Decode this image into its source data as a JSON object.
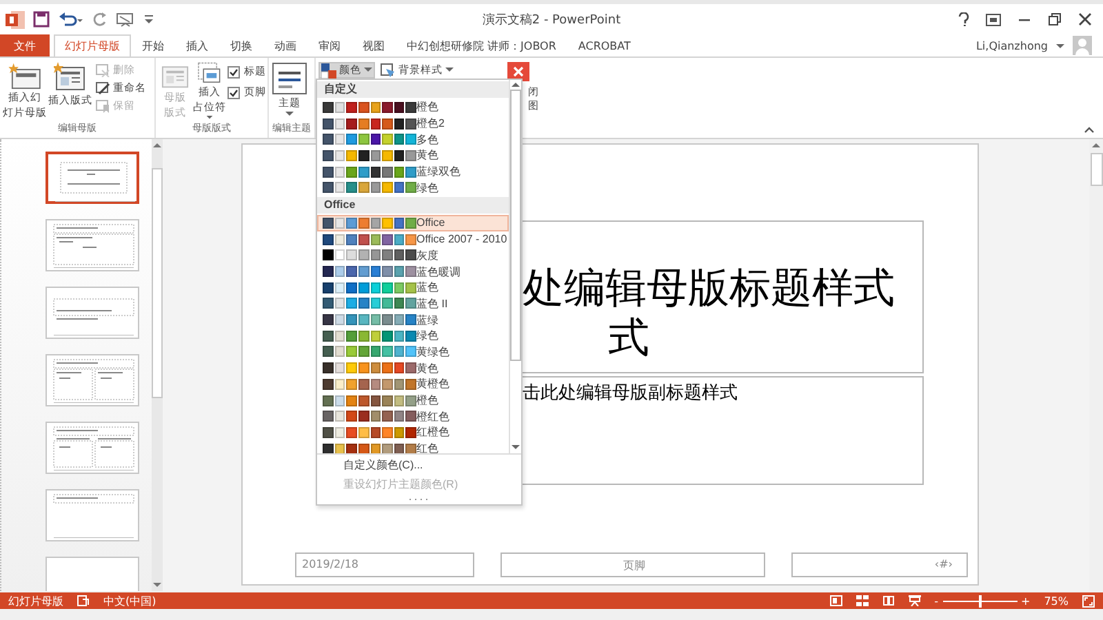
{
  "window": {
    "title": "演示文稿2 - PowerPoint"
  },
  "tabs": [
    {
      "label": "文件",
      "kind": "file",
      "selected": false
    },
    {
      "label": "幻灯片母版",
      "kind": "tab",
      "selected": true
    },
    {
      "label": "开始",
      "kind": "tab",
      "selected": false
    },
    {
      "label": "插入",
      "kind": "tab",
      "selected": false
    },
    {
      "label": "切换",
      "kind": "tab",
      "selected": false
    },
    {
      "label": "动画",
      "kind": "tab",
      "selected": false
    },
    {
      "label": "审阅",
      "kind": "tab",
      "selected": false
    },
    {
      "label": "视图",
      "kind": "tab",
      "selected": false
    },
    {
      "label": "中幻创想研修院 讲师：JOBOR",
      "kind": "tab",
      "selected": false
    },
    {
      "label": "ACROBAT",
      "kind": "tab",
      "selected": false
    }
  ],
  "account": {
    "name": "Li,Qianzhong"
  },
  "ribbon": {
    "groups": [
      {
        "label": "编辑母版",
        "items": [
          {
            "kind": "large",
            "lines": [
              "插入幻",
              "灯片母版"
            ],
            "disabled": false,
            "menu": false
          },
          {
            "kind": "large",
            "lines": [
              "插入版式"
            ],
            "disabled": false,
            "menu": false
          },
          {
            "kind": "stack",
            "items": [
              {
                "label": "删除",
                "disabled": true
              },
              {
                "label": "重命名",
                "disabled": false
              },
              {
                "label": "保留",
                "disabled": true
              }
            ]
          }
        ]
      },
      {
        "label": "母版版式",
        "items": [
          {
            "kind": "large",
            "lines": [
              "母版",
              "版式"
            ],
            "disabled": true,
            "menu": false
          },
          {
            "kind": "large",
            "lines": [
              "插入",
              "占位符"
            ],
            "disabled": false,
            "menu": true
          },
          {
            "kind": "checks",
            "items": [
              {
                "label": "标题",
                "checked": true
              },
              {
                "label": "页脚",
                "checked": true
              }
            ]
          }
        ]
      },
      {
        "label": "编辑主题",
        "items": [
          {
            "kind": "large",
            "lines": [
              "主题"
            ],
            "disabled": false,
            "menu": true
          }
        ]
      },
      {
        "items": [
          {
            "kind": "split",
            "items": [
              {
                "label": "颜色",
                "pressed": true
              },
              {
                "label": "背景样式",
                "pressed": false
              }
            ]
          }
        ]
      }
    ],
    "close_group": {
      "lines": [
        "闭",
        "图"
      ]
    }
  },
  "thumbnails": [
    {
      "kind": "title",
      "selected": true
    },
    {
      "kind": "content",
      "selected": false
    },
    {
      "kind": "section",
      "selected": false
    },
    {
      "kind": "two",
      "selected": false
    },
    {
      "kind": "comparison",
      "selected": false
    },
    {
      "kind": "title_only",
      "selected": false
    },
    {
      "kind": "blank",
      "selected": false
    }
  ],
  "slide": {
    "title_lines": [
      "处编辑母版标题样式",
      "式"
    ],
    "subtitle": "击此处编辑母版副标题样式",
    "date": "2019/2/18",
    "footer": "页脚",
    "page_number": "‹#›"
  },
  "colors_menu": {
    "sections": [
      {
        "header": "自定义",
        "palettes": [
          {
            "name": "橙色",
            "selected": false,
            "swatches": [
              {
                "color": "#3a3a3a"
              },
              {
                "color": "#e0e0e0"
              },
              {
                "color": "#c0201c"
              },
              {
                "color": "#d9531e"
              },
              {
                "color": "#e8a21a"
              },
              {
                "color": "#8b1a2c"
              },
              {
                "color": "#4a0f1f"
              },
              {
                "color": "#3a3a3a"
              }
            ]
          },
          {
            "name": "橙色2",
            "selected": false,
            "swatches": [
              {
                "color": "#44546a"
              },
              {
                "color": "#e7e6e6"
              },
              {
                "color": "#a51c1c"
              },
              {
                "color": "#e57d22"
              },
              {
                "color": "#c8261f"
              },
              {
                "color": "#d55a1a"
              },
              {
                "color": "#222222"
              },
              {
                "color": "#555555"
              }
            ]
          },
          {
            "name": "多色",
            "selected": false,
            "swatches": [
              {
                "color": "#44546a"
              },
              {
                "color": "#e7e6e6"
              },
              {
                "color": "#1e9be0"
              },
              {
                "color": "#8dc63f"
              },
              {
                "color": "#4b16a8"
              },
              {
                "color": "#c4d12d"
              },
              {
                "color": "#0d9488"
              },
              {
                "color": "#13b5d8"
              }
            ]
          },
          {
            "name": "黄色",
            "selected": false,
            "swatches": [
              {
                "color": "#44546a"
              },
              {
                "color": "#e7e6e6"
              },
              {
                "color": "#f5b800"
              },
              {
                "color": "#222222"
              },
              {
                "color": "#999999"
              },
              {
                "color": "#f5b800"
              },
              {
                "color": "#222222"
              },
              {
                "color": "#999999"
              }
            ]
          },
          {
            "name": "蓝绿双色",
            "selected": false,
            "swatches": [
              {
                "color": "#44546a"
              },
              {
                "color": "#e7e6e6"
              },
              {
                "color": "#6aa61b"
              },
              {
                "color": "#2f9dc8"
              },
              {
                "color": "#333333"
              },
              {
                "color": "#777777"
              },
              {
                "color": "#6aa61b"
              },
              {
                "color": "#2f9dc8"
              }
            ]
          },
          {
            "name": "绿色",
            "selected": false,
            "swatches": [
              {
                "color": "#44546a"
              },
              {
                "color": "#e7e6e6"
              },
              {
                "color": "#268f8a"
              },
              {
                "color": "#d9a63a"
              },
              {
                "color": "#999999"
              },
              {
                "color": "#f5b800"
              },
              {
                "color": "#4472c4"
              },
              {
                "color": "#70ad47"
              }
            ]
          }
        ]
      },
      {
        "header": "Office",
        "palettes": [
          {
            "name": "Office",
            "selected": true,
            "swatches": [
              {
                "color": "#44546a"
              },
              {
                "color": "#e7e6e6"
              },
              {
                "color": "#5b9bd5"
              },
              {
                "color": "#ed7d31"
              },
              {
                "color": "#a5a5a5"
              },
              {
                "color": "#ffc000"
              },
              {
                "color": "#4472c4"
              },
              {
                "color": "#70ad47"
              }
            ]
          },
          {
            "name": "Office 2007 - 2010",
            "selected": false,
            "swatches": [
              {
                "color": "#1f497d"
              },
              {
                "color": "#eeece1"
              },
              {
                "color": "#4f81bd"
              },
              {
                "color": "#c0504d"
              },
              {
                "color": "#9bbb59"
              },
              {
                "color": "#8064a2"
              },
              {
                "color": "#4bacc6"
              },
              {
                "color": "#f79646"
              }
            ]
          },
          {
            "name": "灰度",
            "selected": false,
            "swatches": [
              {
                "color": "#000000"
              },
              {
                "color": "#ffffff"
              },
              {
                "color": "#dddddd"
              },
              {
                "color": "#b2b2b2"
              },
              {
                "color": "#969696"
              },
              {
                "color": "#808080"
              },
              {
                "color": "#5f5f5f"
              },
              {
                "color": "#4d4d4d"
              }
            ]
          },
          {
            "name": "蓝色暖调",
            "selected": false,
            "swatches": [
              {
                "color": "#242852"
              },
              {
                "color": "#acccea"
              },
              {
                "color": "#4a66ac"
              },
              {
                "color": "#629dd1"
              },
              {
                "color": "#297fd5"
              },
              {
                "color": "#7f8fa9"
              },
              {
                "color": "#5aa2ae"
              },
              {
                "color": "#9d90a0"
              }
            ]
          },
          {
            "name": "蓝色",
            "selected": false,
            "swatches": [
              {
                "color": "#17406d"
              },
              {
                "color": "#dbeff9"
              },
              {
                "color": "#0f6fc6"
              },
              {
                "color": "#009dd9"
              },
              {
                "color": "#0bd0d9"
              },
              {
                "color": "#10cf9b"
              },
              {
                "color": "#7cca62"
              },
              {
                "color": "#a5c249"
              }
            ]
          },
          {
            "name": "蓝色 II",
            "selected": false,
            "swatches": [
              {
                "color": "#335b74"
              },
              {
                "color": "#dfe3e5"
              },
              {
                "color": "#1cade4"
              },
              {
                "color": "#2683c6"
              },
              {
                "color": "#27ced7"
              },
              {
                "color": "#42ba97"
              },
              {
                "color": "#3e8853"
              },
              {
                "color": "#62a39f"
              }
            ]
          },
          {
            "name": "蓝绿",
            "selected": false,
            "swatches": [
              {
                "color": "#373545"
              },
              {
                "color": "#cedbe6"
              },
              {
                "color": "#3494ba"
              },
              {
                "color": "#58b6c0"
              },
              {
                "color": "#75bda7"
              },
              {
                "color": "#7a8c8e"
              },
              {
                "color": "#84acb6"
              },
              {
                "color": "#2683c6"
              }
            ]
          },
          {
            "name": "绿色",
            "selected": false,
            "swatches": [
              {
                "color": "#455f51"
              },
              {
                "color": "#e3ded1"
              },
              {
                "color": "#549e39"
              },
              {
                "color": "#8ab833"
              },
              {
                "color": "#c0cf3a"
              },
              {
                "color": "#029676"
              },
              {
                "color": "#4ab5c4"
              },
              {
                "color": "#0989b1"
              }
            ]
          },
          {
            "name": "黄绿色",
            "selected": false,
            "swatches": [
              {
                "color": "#455f51"
              },
              {
                "color": "#e3ded1"
              },
              {
                "color": "#99cb38"
              },
              {
                "color": "#63a537"
              },
              {
                "color": "#37a76f"
              },
              {
                "color": "#44c1a3"
              },
              {
                "color": "#4eb3cf"
              },
              {
                "color": "#51c3f9"
              }
            ]
          },
          {
            "name": "黄色",
            "selected": false,
            "swatches": [
              {
                "color": "#39302a"
              },
              {
                "color": "#e5dedb"
              },
              {
                "color": "#ffca08"
              },
              {
                "color": "#f8931d"
              },
              {
                "color": "#ce8d3e"
              },
              {
                "color": "#ec7016"
              },
              {
                "color": "#e64823"
              },
              {
                "color": "#9c6a6a"
              }
            ]
          },
          {
            "name": "黄橙色",
            "selected": false,
            "swatches": [
              {
                "color": "#4e3b30"
              },
              {
                "color": "#fbeec9"
              },
              {
                "color": "#f0a22e"
              },
              {
                "color": "#a5644e"
              },
              {
                "color": "#b58b80"
              },
              {
                "color": "#c3986d"
              },
              {
                "color": "#a19574"
              },
              {
                "color": "#c17529"
              }
            ]
          },
          {
            "name": "橙色",
            "selected": false,
            "swatches": [
              {
                "color": "#637052"
              },
              {
                "color": "#ccddea"
              },
              {
                "color": "#e48312"
              },
              {
                "color": "#bd582c"
              },
              {
                "color": "#865640"
              },
              {
                "color": "#9b8357"
              },
              {
                "color": "#c2bc80"
              },
              {
                "color": "#94a088"
              }
            ]
          },
          {
            "name": "橙红色",
            "selected": false,
            "swatches": [
              {
                "color": "#696464"
              },
              {
                "color": "#e9e5dc"
              },
              {
                "color": "#d34817"
              },
              {
                "color": "#9b2d1f"
              },
              {
                "color": "#a28e6a"
              },
              {
                "color": "#956251"
              },
              {
                "color": "#918485"
              },
              {
                "color": "#855d5d"
              }
            ]
          },
          {
            "name": "红橙色",
            "selected": false,
            "swatches": [
              {
                "color": "#505046"
              },
              {
                "color": "#eeece1"
              },
              {
                "color": "#e84c22"
              },
              {
                "color": "#ffbd47"
              },
              {
                "color": "#b64926"
              },
              {
                "color": "#ff8427"
              },
              {
                "color": "#cc9900"
              },
              {
                "color": "#b22600"
              }
            ]
          },
          {
            "name": "红色",
            "selected": false,
            "swatches": [
              {
                "color": "#2e2e2e"
              },
              {
                "color": "#e8c04b"
              },
              {
                "color": "#a5300f"
              },
              {
                "color": "#d55816"
              },
              {
                "color": "#e19825"
              },
              {
                "color": "#b19c7d"
              },
              {
                "color": "#7f5f52"
              },
              {
                "color": "#b27d49"
              }
            ]
          }
        ]
      }
    ],
    "commands": [
      {
        "label": "自定义颜色(C)...",
        "disabled": false
      },
      {
        "label": "重设幻灯片主题颜色(R)",
        "disabled": true
      }
    ]
  },
  "status_bar": {
    "mode": "幻灯片母版",
    "language": "中文(中国)",
    "zoom_out": "-",
    "zoom_in": "+",
    "zoom": {
      "level": 0.5
    },
    "zoom_text": "75%"
  }
}
